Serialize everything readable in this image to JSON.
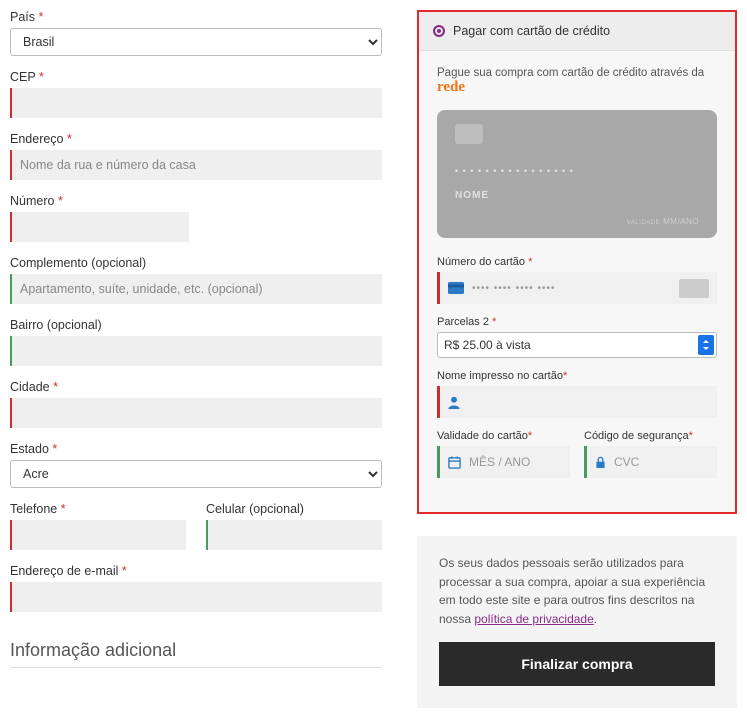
{
  "billing": {
    "country_label": "País",
    "country_value": "Brasil",
    "cep_label": "CEP",
    "address_label": "Endereço",
    "address_placeholder": "Nome da rua e número da casa",
    "number_label": "Número",
    "complement_label": "Complemento (opcional)",
    "complement_placeholder": "Apartamento, suíte, unidade, etc. (opcional)",
    "neighborhood_label": "Bairro (opcional)",
    "city_label": "Cidade",
    "state_label": "Estado",
    "state_value": "Acre",
    "phone_label": "Telefone",
    "mobile_label": "Celular (opcional)",
    "email_label": "Endereço de e-mail",
    "additional_section": "Informação adicional"
  },
  "payment": {
    "method_title": "Pagar com cartão de crédito",
    "desc_prefix": "Pague sua compra com cartão de crédito através da ",
    "brand": "rede",
    "card_illust": {
      "dots": "• • • •   • • • •   • • • •   • • • •",
      "name": "NOME",
      "exp_label": "VALIDADE",
      "exp_value": "MM/ANO"
    },
    "card_number_label": "Número do cartão",
    "card_number_placeholder": "•••• •••• •••• ••••",
    "installments_label": "Parcelas 2",
    "installments_value": "R$ 25.00 à vista",
    "name_on_card_label": "Nome impresso no cartão",
    "expiry_label": "Validade do cartão",
    "expiry_placeholder": "MÊS / ANO",
    "cvc_label": "Código de segurança",
    "cvc_placeholder": "CVC"
  },
  "privacy": {
    "text_prefix": "Os seus dados pessoais serão utilizados para processar a sua compra, apoiar a sua experiência em todo este site e para outros fins descritos na nossa ",
    "link": "política de privacidade",
    "suffix": "."
  },
  "button": {
    "finalize": "Finalizar compra"
  }
}
